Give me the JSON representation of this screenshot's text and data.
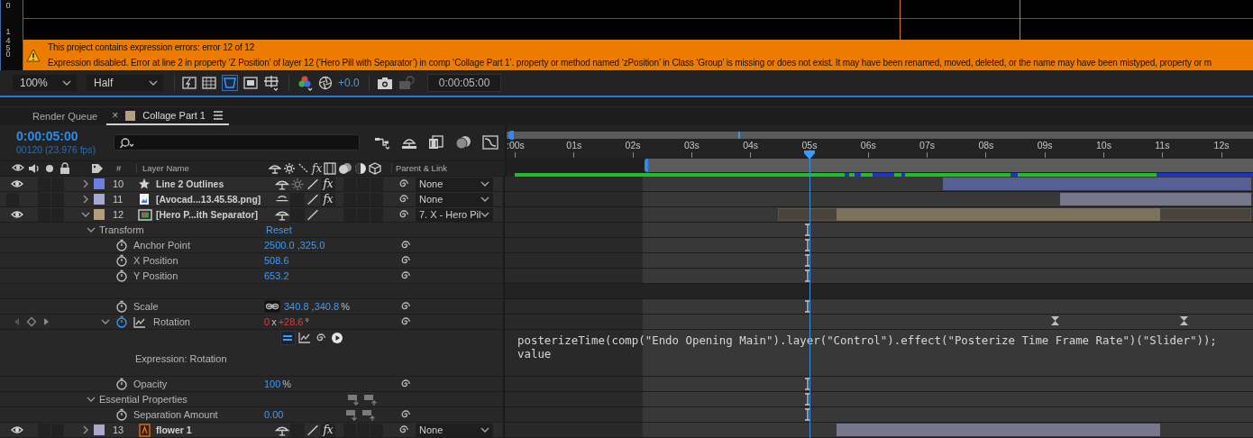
{
  "viewer": {
    "ruler_labels": [
      "0",
      "1",
      "450"
    ],
    "error_banner": {
      "title": "This project contains expression errors: error 12 of 12",
      "message": "Expression disabled. Error at line 2 in property ‘Z Position’ of layer 12 (‘Hero Pill with Separator’) in comp ‘Collage Part 1’.  property or method named ‘zPosition’ in Class ‘Group’ is missing or does not exist. It may have been renamed, moved, deleted, or the name may have been mistyped, property or m"
    },
    "toolbar": {
      "zoom": "100%",
      "resolution": "Half",
      "exposure": "+0.0",
      "timecode": "0:00:05:00"
    }
  },
  "tabs": [
    {
      "label": "Render Queue",
      "selected": false
    },
    {
      "label": "Collage Part 1",
      "selected": true,
      "close": "×",
      "color": "#b39f7b"
    }
  ],
  "timeline": {
    "current_time": "0:00:05:00",
    "frame_info": "00120 (23.976 fps)",
    "columns": {
      "number": "#",
      "layer_name": "Layer Name",
      "fx": "fx",
      "parent": "Parent & Link"
    },
    "ruler": [
      ":00s",
      "01s",
      "02s",
      "03s",
      "04s",
      "05s",
      "06s",
      "07s",
      "08s",
      "09s",
      "10s",
      "11s",
      "12s"
    ],
    "cache": [
      {
        "kind": "cached"
      },
      {
        "kind": "uncached"
      },
      {
        "kind": "cached"
      },
      {
        "kind": "uncached"
      },
      {
        "kind": "cached"
      },
      {
        "kind": "uncached"
      },
      {
        "kind": "cached"
      },
      {
        "kind": "uncached"
      },
      {
        "kind": "cached"
      },
      {
        "kind": "uncached"
      },
      {
        "kind": "cached"
      },
      {
        "kind": "uncached"
      }
    ],
    "rows": [
      {
        "kind": "layer",
        "number": "10",
        "name": "Line 2 Outlines",
        "icon": {
          "kind": "shape"
        },
        "visible": true,
        "expanded": false,
        "color": "#6f7fe0",
        "switches": [
          {
            "kind": "shy"
          },
          {
            "kind": "collapse"
          },
          {
            "kind": "quality"
          },
          {
            "kind": "fx",
            "label": "fx",
            "on": true
          }
        ],
        "parent": "None"
      },
      {
        "kind": "layer",
        "number": "11",
        "name": "[Avocad...13.45.58.png]",
        "icon": {
          "kind": "image"
        },
        "visible": false,
        "expanded": false,
        "color": "#a9a9cf",
        "switches": [
          {
            "kind": "shy_off"
          },
          {
            "kind": "empty"
          },
          {
            "kind": "quality"
          },
          {
            "kind": "fx",
            "label": "fx",
            "on": true
          }
        ],
        "parent": "None"
      },
      {
        "kind": "layer",
        "number": "12",
        "name": "[Hero P...ith Separator]",
        "icon": {
          "kind": "comp"
        },
        "visible": true,
        "expanded": true,
        "color": "#b39f7b",
        "switches": [
          {
            "kind": "shy"
          },
          {
            "kind": "empty"
          },
          {
            "kind": "quality"
          },
          {
            "kind": "none"
          }
        ],
        "parent": "7. X - Hero Pil"
      },
      {
        "kind": "group",
        "label": "Transform",
        "expanded": true,
        "action": "Reset"
      },
      {
        "kind": "property",
        "label": "Anchor Point",
        "stopwatch": false,
        "value": [
          {
            "text": "2500.0 ,325.0",
            "kind": "number"
          }
        ]
      },
      {
        "kind": "property",
        "label": "X Position",
        "stopwatch": false,
        "value": [
          {
            "text": "508.6",
            "kind": "number"
          }
        ]
      },
      {
        "kind": "property",
        "label": "Y Position",
        "stopwatch": false,
        "value": [
          {
            "text": "653.2",
            "kind": "number"
          }
        ]
      },
      {
        "kind": "spacer"
      },
      {
        "kind": "property",
        "label": "Scale",
        "stopwatch": false,
        "constrain": true,
        "value": [
          {
            "text": "340.8 ,340.8",
            "kind": "number"
          },
          {
            "text": "%",
            "kind": "unit"
          }
        ]
      },
      {
        "kind": "property",
        "label": "Rotation",
        "stopwatch": true,
        "expanded": true,
        "keyframe_nav": true,
        "graph": true,
        "value": [
          {
            "text": "0",
            "kind": "error"
          },
          {
            "text": "x",
            "kind": "unit"
          },
          {
            "text": "+28.6",
            "kind": "error"
          },
          {
            "text": "°",
            "kind": "unit"
          }
        ]
      },
      {
        "kind": "expression",
        "label": "Expression: Rotation",
        "enabled": true,
        "code": [
          "posterizeTime(comp(\"Endo Opening Main\").layer(\"Control\").effect(\"Posterize Time Frame Rate\")(\"Slider\"));",
          "value"
        ]
      },
      {
        "kind": "property",
        "label": "Opacity",
        "stopwatch": false,
        "value": [
          {
            "text": "100",
            "kind": "number"
          },
          {
            "text": "%",
            "kind": "unit"
          }
        ]
      },
      {
        "kind": "group",
        "label": "Essential Properties",
        "expanded": true,
        "pins": true
      },
      {
        "kind": "property",
        "label": "Separation Amount",
        "stopwatch": false,
        "pins": true,
        "value": [
          {
            "text": "0.00",
            "kind": "number"
          }
        ]
      },
      {
        "kind": "layer",
        "number": "13",
        "name": "flower 1",
        "icon": {
          "kind": "vector"
        },
        "visible": true,
        "expanded": false,
        "color": "#a9a9cf",
        "switches": [
          {
            "kind": "shy"
          },
          {
            "kind": "empty"
          },
          {
            "kind": "quality"
          },
          {
            "kind": "fx",
            "label": "fx",
            "on": true
          }
        ],
        "parent": "None"
      }
    ]
  }
}
